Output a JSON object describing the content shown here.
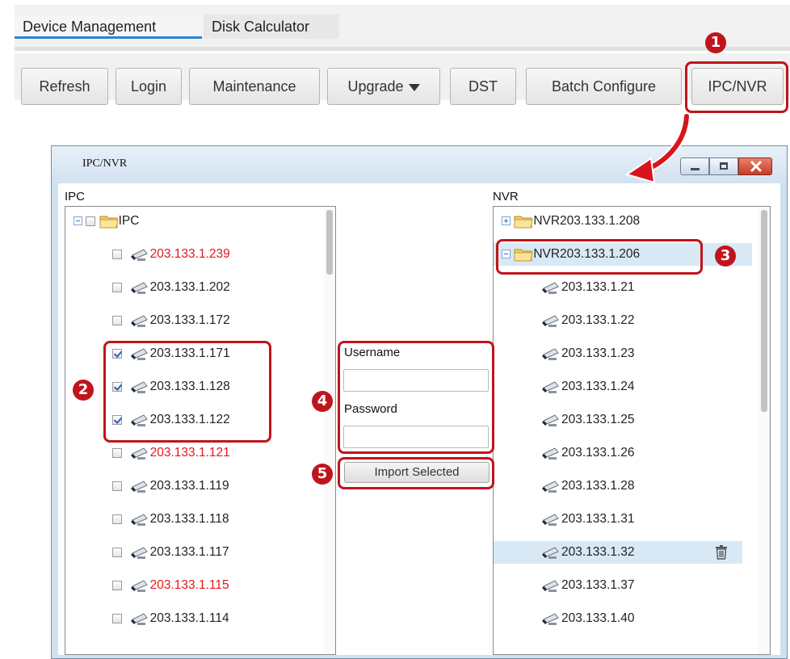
{
  "tabs": [
    {
      "label": "Device Management",
      "active": true
    },
    {
      "label": "Disk Calculator",
      "active": false
    }
  ],
  "toolbar": {
    "refresh": "Refresh",
    "login": "Login",
    "maintenance": "Maintenance",
    "upgrade": "Upgrade",
    "dst": "DST",
    "batch_configure": "Batch Configure",
    "ipc_nvr": "IPC/NVR"
  },
  "callouts": [
    "1",
    "2",
    "3",
    "4",
    "5"
  ],
  "dialog": {
    "title": "IPC/NVR",
    "ipc_label": "IPC",
    "nvr_label": "NVR",
    "ipc_root": "IPC",
    "ipc_items": [
      {
        "ip": "203.133.1.239",
        "checked": false,
        "offline": true
      },
      {
        "ip": "203.133.1.202",
        "checked": false,
        "offline": false
      },
      {
        "ip": "203.133.1.172",
        "checked": false,
        "offline": false
      },
      {
        "ip": "203.133.1.171",
        "checked": true,
        "offline": false
      },
      {
        "ip": "203.133.1.128",
        "checked": true,
        "offline": false
      },
      {
        "ip": "203.133.1.122",
        "checked": true,
        "offline": false
      },
      {
        "ip": "203.133.1.121",
        "checked": false,
        "offline": true
      },
      {
        "ip": "203.133.1.119",
        "checked": false,
        "offline": false
      },
      {
        "ip": "203.133.1.118",
        "checked": false,
        "offline": false
      },
      {
        "ip": "203.133.1.117",
        "checked": false,
        "offline": false
      },
      {
        "ip": "203.133.1.115",
        "checked": false,
        "offline": true
      },
      {
        "ip": "203.133.1.114",
        "checked": false,
        "offline": false
      }
    ],
    "nvr_nodes": [
      {
        "label": "NVR203.133.1.208",
        "expanded": false
      },
      {
        "label": "NVR203.133.1.206",
        "expanded": true
      }
    ],
    "nvr_children": [
      "203.133.1.21",
      "203.133.1.22",
      "203.133.1.23",
      "203.133.1.24",
      "203.133.1.25",
      "203.133.1.26",
      "203.133.1.28",
      "203.133.1.31",
      "203.133.1.32",
      "203.133.1.37",
      "203.133.1.40"
    ],
    "username_label": "Username",
    "username_value": "",
    "password_label": "Password",
    "password_value": "",
    "import_button": "Import Selected"
  },
  "colors": {
    "callout_red": "#c0141c",
    "offline_text": "#e3161b",
    "selection_bg": "#d8e9f5",
    "tab_accent": "#2b82d9"
  },
  "icons": [
    "folder-icon",
    "camera-icon",
    "trash-icon",
    "minimize-icon",
    "maximize-icon",
    "close-icon",
    "dropdown-arrow-icon"
  ]
}
